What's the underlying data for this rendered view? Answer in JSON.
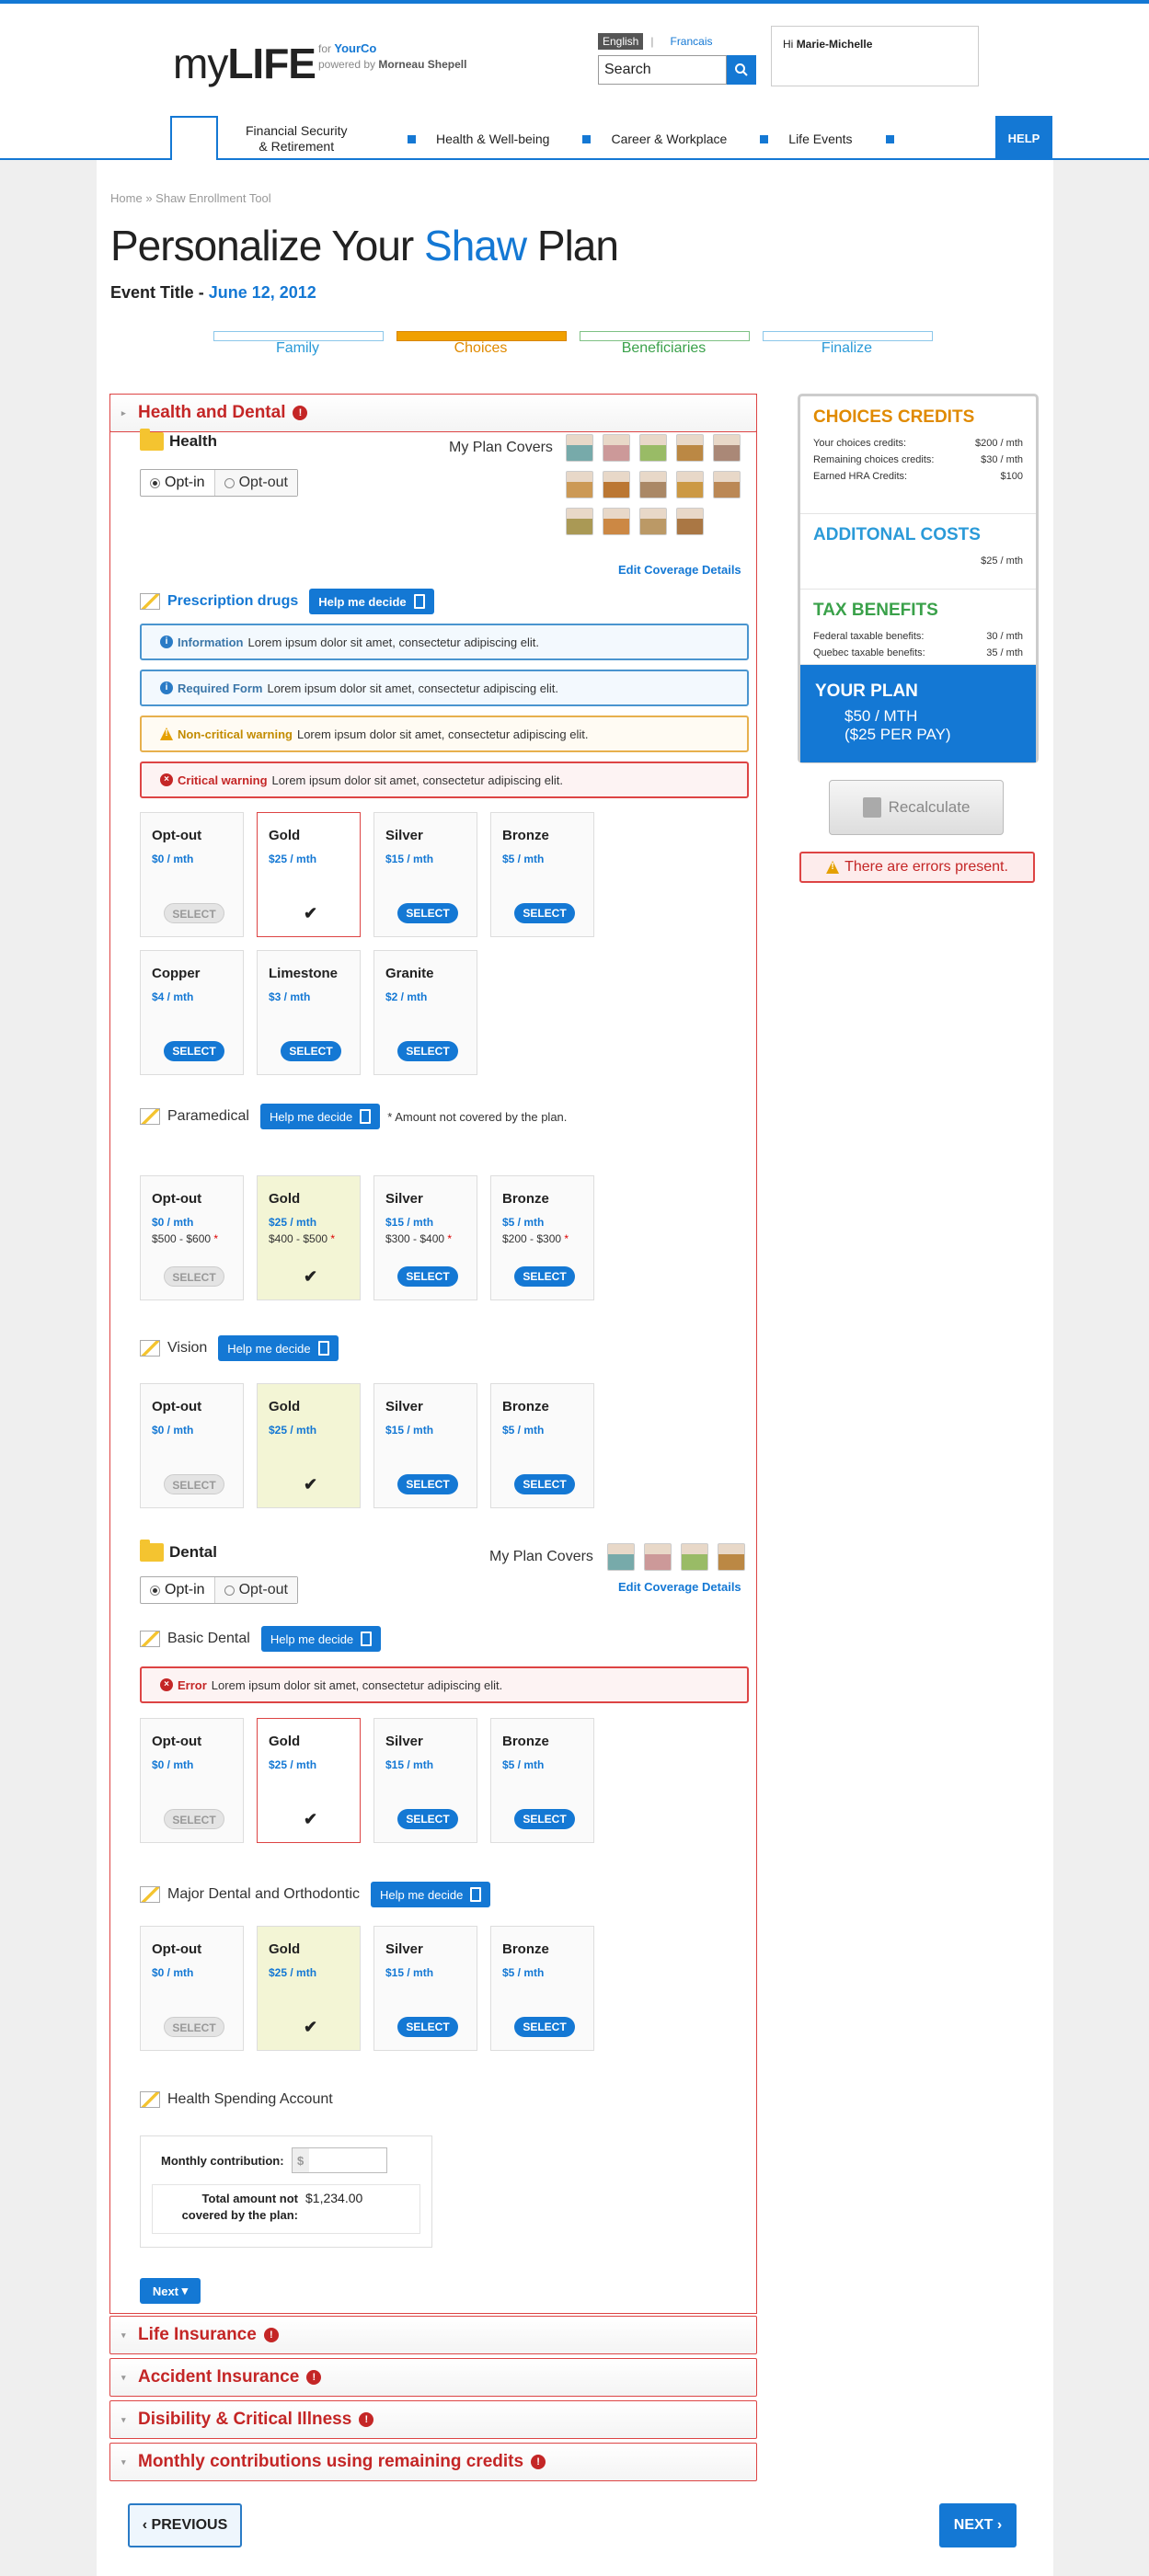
{
  "header": {
    "logo_my": "my",
    "logo_life": "LIFE",
    "for": "for",
    "brand": "YourCo",
    "powered": "powered by",
    "ms": "Morneau Shepell",
    "lang_current": "English",
    "lang_alt": "Francais",
    "search_placeholder": "Search",
    "user_hi": "Hi",
    "user_name": "Marie-Michelle"
  },
  "nav": {
    "items": [
      "Financial Security\n& Retirement",
      "Health & Well-being",
      "Career & Workplace",
      "Life Events"
    ],
    "help": "HELP"
  },
  "crumb": {
    "home": "Home",
    "sep": "»",
    "current": "Shaw Enrollment Tool"
  },
  "title": {
    "a": "Personalize Your",
    "shaw": "Shaw",
    "b": "Plan"
  },
  "event": {
    "label": "Event Title -",
    "date": "June 12, 2012"
  },
  "steps": [
    "Family",
    "Choices",
    "Beneficiaries",
    "Finalize"
  ],
  "section1": "Health and Dental",
  "health": {
    "title": "Health",
    "optin": "Opt-in",
    "optout": "Opt-out",
    "covers": "My Plan Covers",
    "edit": "Edit Coverage Details",
    "dental_title": "Dental"
  },
  "help_label": "Help me decide",
  "rx": {
    "title": "Prescription drugs"
  },
  "alerts": {
    "info_b": "Information",
    "info": "Lorem ipsum dolor sit amet, consectetur adipiscing elit.",
    "req_b": "Required Form",
    "req": "Lorem ipsum dolor sit amet, consectetur adipiscing elit.",
    "warn_b": "Non-critical warning",
    "warn": "Lorem ipsum dolor sit amet, consectetur adipiscing elit.",
    "crit_b": "Critical warning",
    "crit": "Lorem ipsum dolor sit amet, consectetur adipiscing elit.",
    "err_b": "Error",
    "err": "Lorem ipsum dolor sit amet, consectetur adipiscing elit."
  },
  "select": "SELECT",
  "rx_cards": [
    {
      "n": "Opt-out",
      "p": "$0 / mth"
    },
    {
      "n": "Gold",
      "p": "$25 / mth"
    },
    {
      "n": "Silver",
      "p": "$15 / mth"
    },
    {
      "n": "Bronze",
      "p": "$5 / mth"
    },
    {
      "n": "Copper",
      "p": "$4 / mth"
    },
    {
      "n": "Limestone",
      "p": "$3 / mth"
    },
    {
      "n": "Granite",
      "p": "$2 / mth"
    }
  ],
  "para": {
    "title": "Paramedical",
    "note": "* Amount not covered by the plan."
  },
  "para_cards": [
    {
      "n": "Opt-out",
      "p": "$0 / mth",
      "r": "$500 - $600"
    },
    {
      "n": "Gold",
      "p": "$25 / mth",
      "r": "$400 - $500"
    },
    {
      "n": "Silver",
      "p": "$15 / mth",
      "r": "$300 - $400"
    },
    {
      "n": "Bronze",
      "p": "$5 / mth",
      "r": "$200 - $300"
    }
  ],
  "vision": {
    "title": "Vision"
  },
  "std_cards": [
    {
      "n": "Opt-out",
      "p": "$0 / mth"
    },
    {
      "n": "Gold",
      "p": "$25 / mth"
    },
    {
      "n": "Silver",
      "p": "$15 / mth"
    },
    {
      "n": "Bronze",
      "p": "$5 / mth"
    }
  ],
  "basic": {
    "title": "Basic Dental"
  },
  "major": {
    "title": "Major Dental and Orthodontic"
  },
  "hsa": {
    "title": "Health Spending Account",
    "monthly": "Monthly contribution:",
    "cur": "$",
    "total_l": "Total amount not covered by the plan:",
    "total_v": "$1,234.00"
  },
  "next_small": "Next",
  "sections": [
    "Life Insurance",
    "Accident Insurance",
    "Disibility & Critical Illness",
    "Monthly contributions using remaining credits"
  ],
  "side": {
    "c_title": "CHOICES CREDITS",
    "c_rows": [
      [
        "Your choices credits:",
        "$200 / mth"
      ],
      [
        "Remaining choices credits:",
        "$30 / mth"
      ],
      [
        "Earned HRA Credits:",
        "$100"
      ]
    ],
    "a_title": "ADDITONAL COSTS",
    "a_val": "$25 / mth",
    "t_title": "TAX BENEFITS",
    "t_rows": [
      [
        "Federal taxable benefits:",
        "30 / mth"
      ],
      [
        "Quebec taxable benefits:",
        "35 / mth"
      ]
    ],
    "p_title": "YOUR PLAN",
    "p1": "$50 / MTH",
    "p2": "($25 PER PAY)"
  },
  "recalc": "Recalculate",
  "errors": "There are errors present.",
  "prev": "PREVIOUS",
  "next": "NEXT",
  "colors": {
    "accent": "#1478d4",
    "error": "#c42626",
    "choices": "#e08a00",
    "benefit": "#3aa14a"
  }
}
